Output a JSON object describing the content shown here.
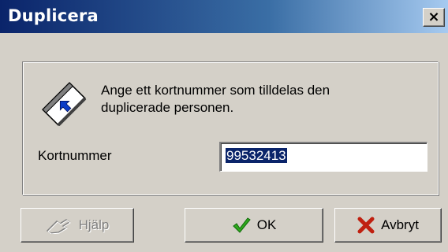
{
  "window": {
    "title": "Duplicera",
    "close_symbol": "×"
  },
  "dialog": {
    "message_line1": "Ange ett kortnummer som tilldelas den",
    "message_line2": "duplicerade personen.",
    "field_label": "Kortnummer",
    "field_value": "99532413",
    "icon": "card-swipe-icon"
  },
  "buttons": {
    "help_label": "Hjälp",
    "ok_label": "OK",
    "cancel_label": "Avbryt"
  },
  "colors": {
    "titlebar_start": "#0a246a",
    "titlebar_end": "#a6caf0",
    "selection": "#0a246a",
    "ok_check": "#2fa81e",
    "cancel_x": "#c02010"
  }
}
